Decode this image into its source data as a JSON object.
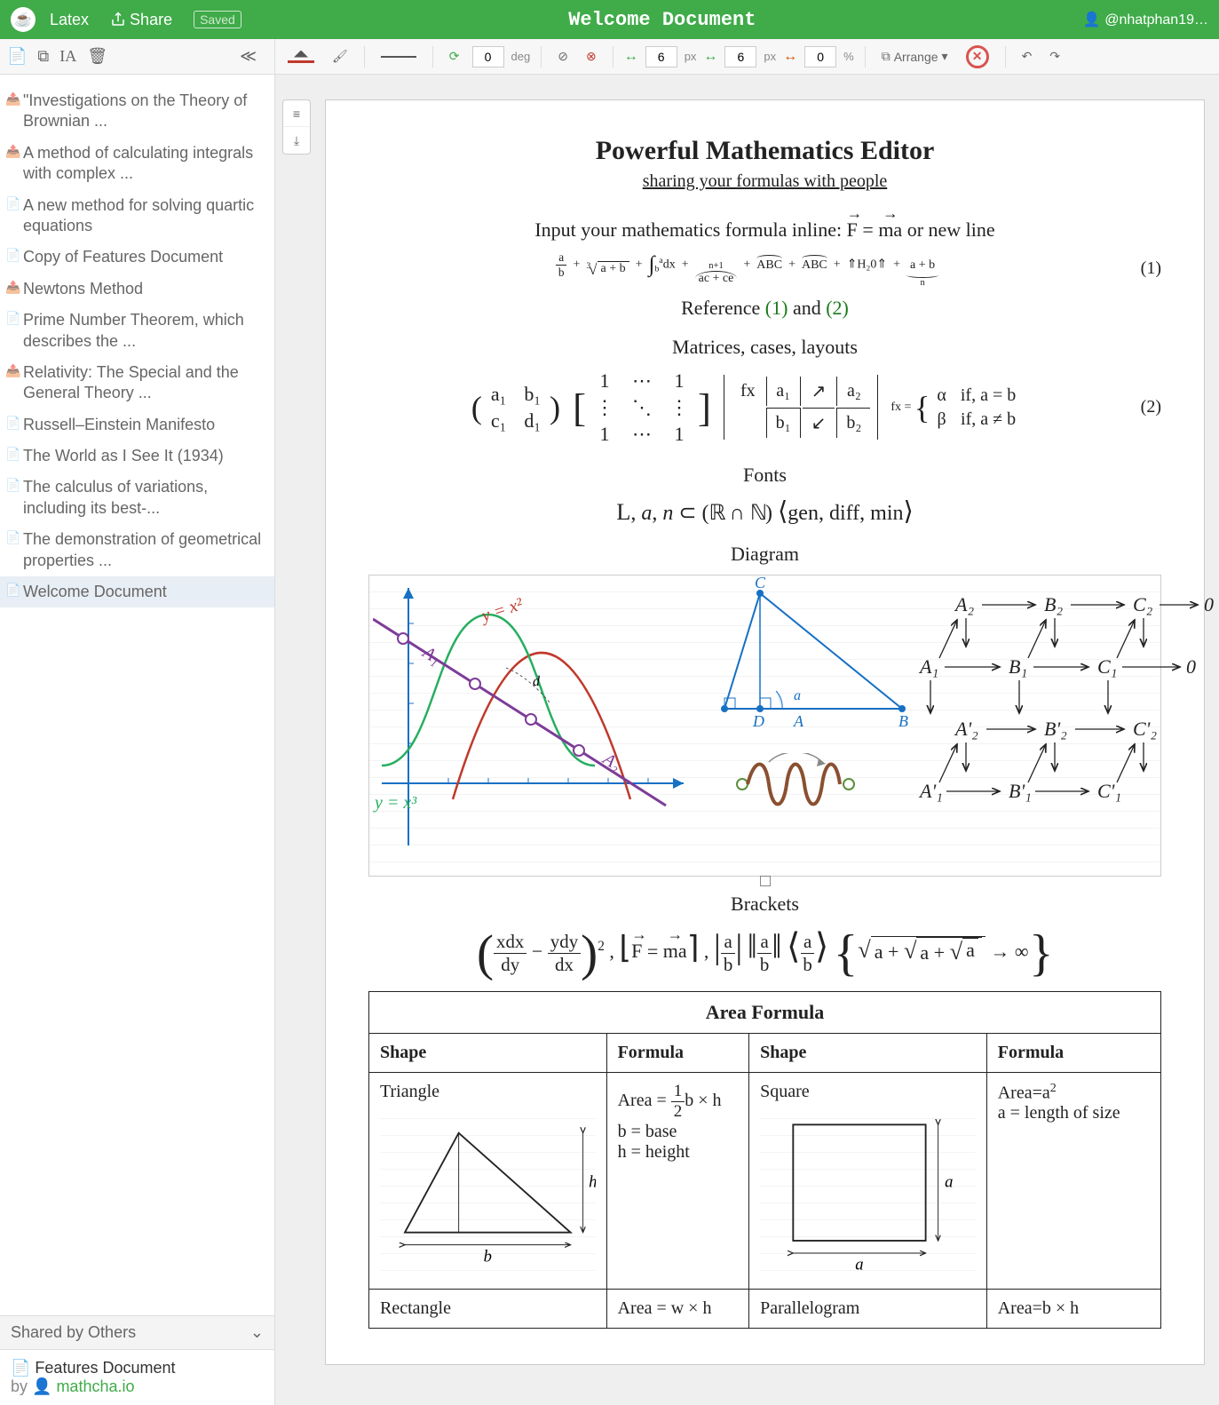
{
  "header": {
    "latex": "Latex",
    "share": "Share",
    "saved": "Saved",
    "title": "Welcome Document",
    "user": "@nhatphan19…"
  },
  "toolbar": {
    "rotation": "0",
    "rotation_unit": "deg",
    "gap_x": "6",
    "gap_x_unit": "px",
    "gap_y": "6",
    "gap_y_unit": "px",
    "scale": "0",
    "scale_unit": "%",
    "arrange": "Arrange"
  },
  "sidebar": {
    "docs": [
      {
        "label": "\"Investigations on the Theory of Brownian ...",
        "shared": true
      },
      {
        "label": "A method of calculating integrals with complex ...",
        "shared": true
      },
      {
        "label": "A new method for solving quartic equations",
        "shared": false
      },
      {
        "label": "Copy of Features Document",
        "shared": false
      },
      {
        "label": "Newtons Method",
        "shared": true
      },
      {
        "label": "Prime Number Theorem, which describes the ...",
        "shared": false
      },
      {
        "label": "Relativity: The Special and the General Theory ...",
        "shared": true
      },
      {
        "label": "Russell–Einstein Manifesto",
        "shared": false
      },
      {
        "label": "The World as I See It (1934)",
        "shared": false
      },
      {
        "label": "The calculus of variations, including its best-...",
        "shared": false
      },
      {
        "label": "The demonstration of geometrical properties ...",
        "shared": false
      },
      {
        "label": "Welcome Document",
        "shared": false,
        "selected": true
      }
    ],
    "shared_section": "Shared by Others",
    "shared_doc": {
      "title": "Features Document",
      "by": "by ",
      "author": "mathcha.io"
    }
  },
  "page": {
    "title": "Powerful Mathematics Editor",
    "subtitle": "sharing your formulas with people",
    "inline_prefix": "Input your mathematics formula inline: ",
    "inline_mid": "  =  ",
    "inline_suffix": " or new line",
    "ref_text_a": "Reference ",
    "ref_text_b": " and ",
    "ref1": "(1)",
    "ref2": "(2)",
    "eqnum1": "(1)",
    "eqnum2": "(2)",
    "sec_matrices": "Matrices, cases, layouts",
    "sec_fonts": "Fonts",
    "fonts_line": "ℒ, 𝑎, 𝑛 ⊂ (ℝ ∩ ℕ) ⟨gen, diff, min⟩",
    "sec_diagram": "Diagram",
    "sec_brackets": "Brackets",
    "table": {
      "caption": "Area Formula",
      "h1": "Shape",
      "h2": "Formula",
      "h3": "Shape",
      "h4": "Formula",
      "r1c1": "Triangle",
      "r1c2a": "Area = ",
      "r1c2b": "b × h",
      "r1c2c": "b = base",
      "r1c2d": "h = height",
      "r1c3": "Square",
      "r1c4a": "Area=a",
      "r1c4b": "a = length of size",
      "r2c1": "Rectangle",
      "r2c2": "Area = w × h",
      "r2c3": "Parallelogram",
      "r2c4": "Area=b × h",
      "tri_b": "b",
      "tri_h": "h",
      "sq_a1": "a",
      "sq_a2": "a"
    },
    "diagram": {
      "y_eq_x2": "y = x²",
      "y_eq_x3": "y = x³",
      "A1": "A₁",
      "A2": "A₂",
      "tri_A": "A",
      "tri_B": "B",
      "tri_C": "C",
      "tri_D": "D",
      "tri_d": "d",
      "tri_a": "a",
      "cd": {
        "A2": "A₂",
        "B2": "B₂",
        "C2": "C₂",
        "zero1": "0",
        "A1": "A₁",
        "B1": "B₁",
        "C1": "C₁",
        "zero2": "0",
        "Ap2": "A'₂",
        "Bp2": "B'₂",
        "Cp2": "C'₂",
        "Ap1": "A'₁",
        "Bp1": "B'₁",
        "Cp1": "C'₁"
      }
    },
    "eq1": {
      "frac_a": "a",
      "frac_b": "b",
      "root_idx": "3",
      "root_arg": "a + b",
      "int_a": "a",
      "int_b": "b",
      "int_arg": "dx",
      "overarc": "ac + ce",
      "overtop": "n+1",
      "arc2": "ABC",
      "arc3": "ABC",
      "chem": "⇑H₂0⇑",
      "under_arg": "a + b",
      "under_sub": "n"
    },
    "eq2": {
      "m_a1": "a₁",
      "m_b1": "b₁",
      "m_c1": "c₁",
      "m_d1": "d₁",
      "det_fx": "fx",
      "det_a1": "a₁",
      "det_a2": "a₂",
      "det_b1": "b₁",
      "det_b2": "b₂",
      "arr_up": "↗",
      "arr_dn": "↙",
      "cases_lhs": "fx = ",
      "c_a": "α",
      "c_a_cond": "if, a = b",
      "c_b": "β",
      "c_b_cond": "if, a ≠ b"
    },
    "brackets": {
      "xdx": "xdx",
      "dy": "dy",
      "ydy": "ydy",
      "dx": "dx",
      "exp2": "2",
      "Feq": "F",
      "ma": "ma",
      "ab_a": "a",
      "ab_b": "b",
      "sqrt_a": "a",
      "arrow_inf": "→ ∞"
    }
  }
}
